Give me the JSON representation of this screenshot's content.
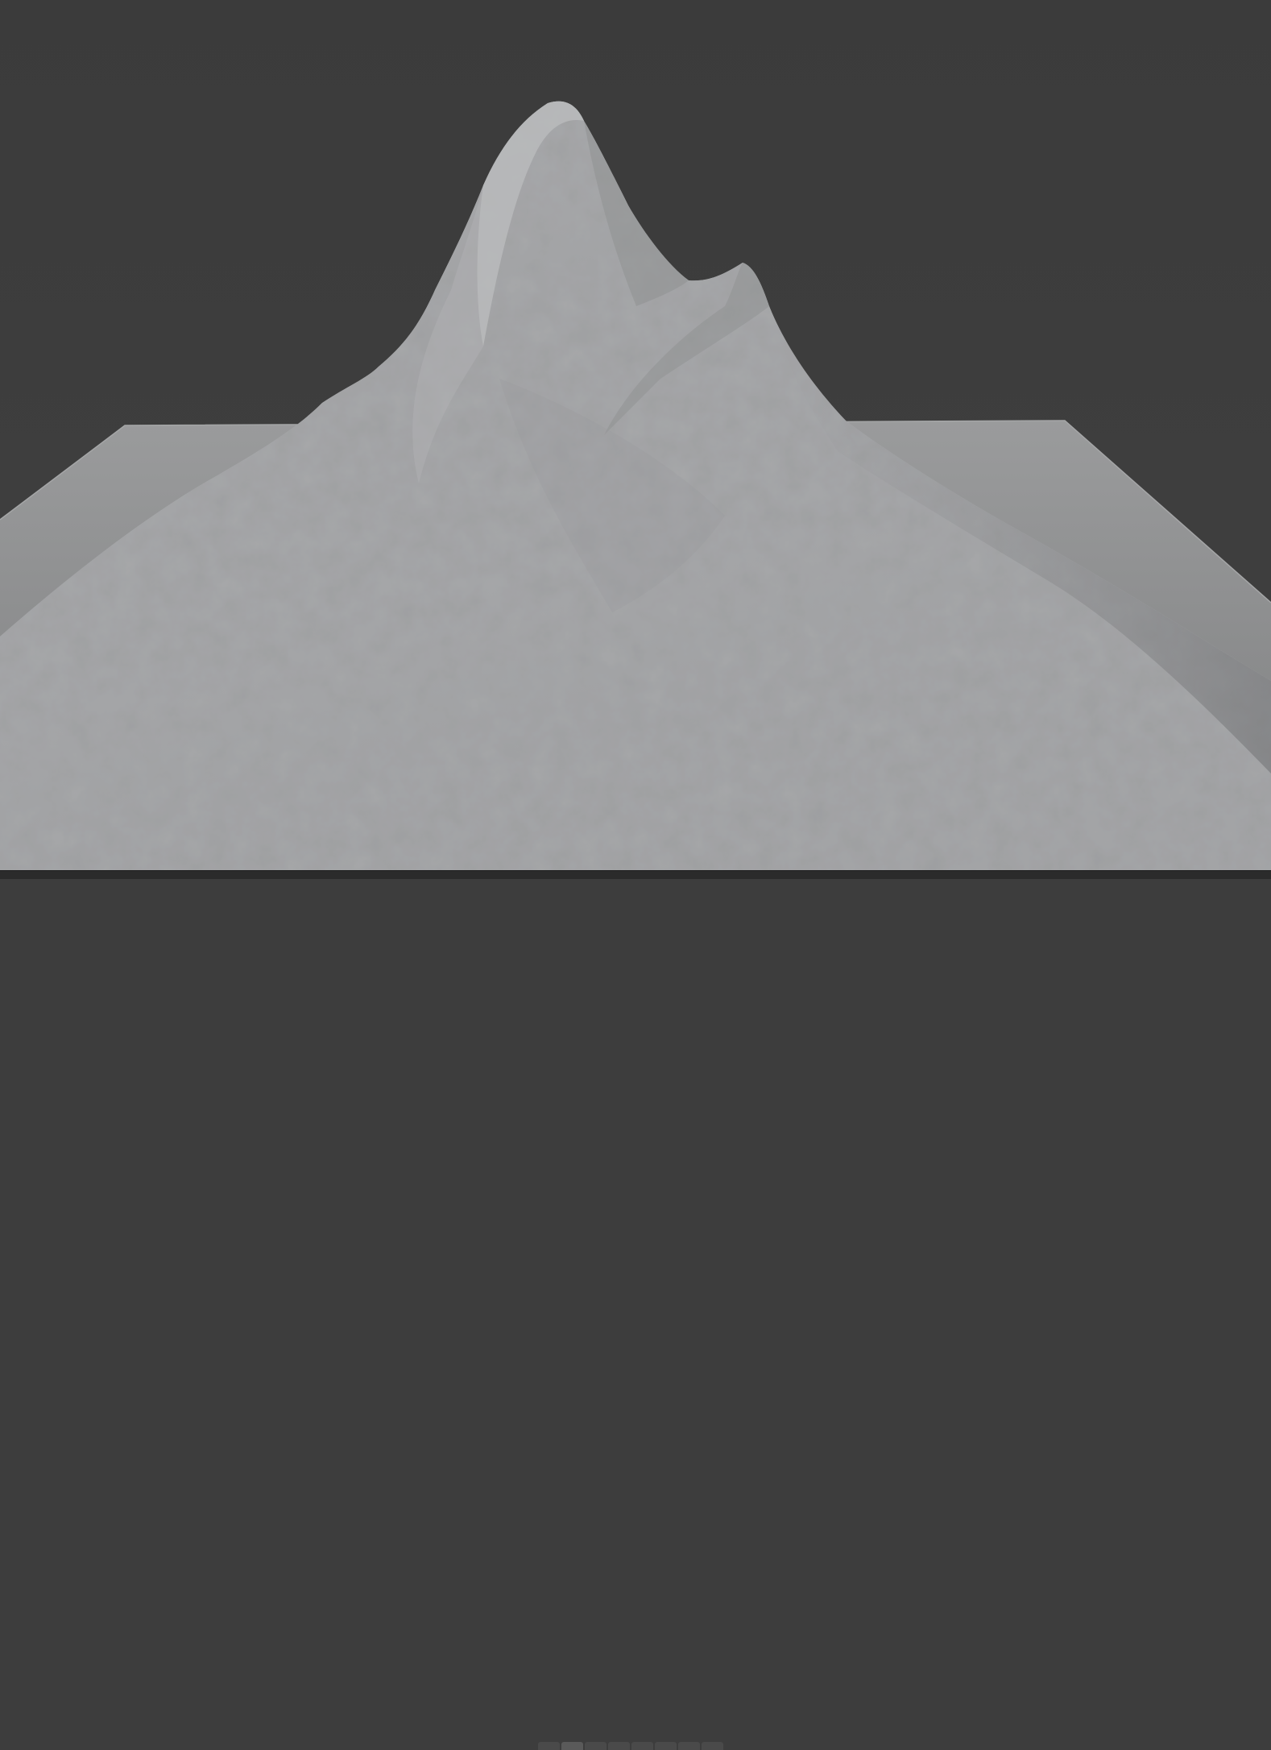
{
  "viewport": {
    "background_color": "#3d3d3d",
    "ground_color": "#8f9091",
    "mesh_color": "#a7a8aa",
    "shading_mode": "solid"
  },
  "statusbar": {
    "background_color": "#2b2b2b",
    "tabs": [
      {
        "icon": "view-tab-icon"
      },
      {
        "icon": "view-tab-icon"
      },
      {
        "icon": "view-tab-icon"
      },
      {
        "icon": "view-tab-icon"
      },
      {
        "icon": "view-tab-icon"
      },
      {
        "icon": "view-tab-icon"
      },
      {
        "icon": "view-tab-icon"
      },
      {
        "icon": "view-tab-icon"
      }
    ]
  }
}
